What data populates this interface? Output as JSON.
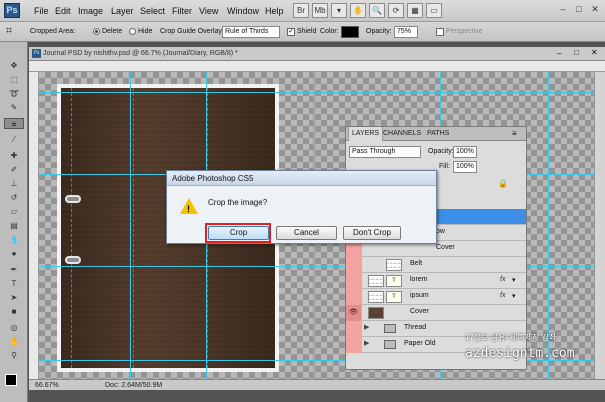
{
  "app": {
    "logo": "Ps"
  },
  "menu": [
    "File",
    "Edit",
    "Image",
    "Layer",
    "Select",
    "Filter",
    "View",
    "Window",
    "Help"
  ],
  "window_controls": {
    "minimize": "–",
    "restore": "□",
    "close": "✕"
  },
  "options_bar": {
    "cropped_area_label": "Cropped Area:",
    "delete_label": "Delete",
    "hide_label": "Hide",
    "guide_overlay_label": "Crop Guide Overlay:",
    "guide_overlay_value": "Rule of Thirds",
    "shield_label": "Shield",
    "color_label": "Color:",
    "color_value": "#000000",
    "opacity_label": "Opacity:",
    "opacity_value": "75%",
    "perspective_label": "Perspective"
  },
  "document": {
    "title": "Journal PSD by nishithv.psd @ 66.7% (Journal/Diary, RGB/8) *",
    "zoom": "66.67%",
    "doc_info": "Doc: 2.64M/50.9M"
  },
  "layers_panel": {
    "tabs": [
      "LAYERS",
      "CHANNELS",
      "PATHS"
    ],
    "blend_mode": "Pass Through",
    "opacity_label": "Opacity:",
    "opacity_value": "100%",
    "fill_label": "Fill:",
    "fill_value": "100%",
    "rows": [
      {
        "name": "ow",
        "type": "layer",
        "fx": false
      },
      {
        "name": "Cover",
        "type": "layer",
        "fx": false
      },
      {
        "name": "Belt",
        "type": "layer",
        "fx": false
      },
      {
        "name": "lorem",
        "type": "text",
        "fx": true
      },
      {
        "name": "ipsum",
        "type": "text",
        "fx": true
      },
      {
        "name": "Cover",
        "type": "layer",
        "fx": false
      },
      {
        "name": "Thread",
        "type": "folder",
        "fx": false
      },
      {
        "name": "Paper Old",
        "type": "folder",
        "fx": false
      }
    ]
  },
  "dialog": {
    "title": "Adobe Photoshop CS5",
    "message": "Crop the image?",
    "buttons": {
      "crop": "Crop",
      "cancel": "Cancel",
      "dont_crop": "Don't Crop"
    }
  },
  "watermark": {
    "line1": "17정보 공유/ 테마제작 강좌",
    "line2": "azdesigntm.com"
  }
}
